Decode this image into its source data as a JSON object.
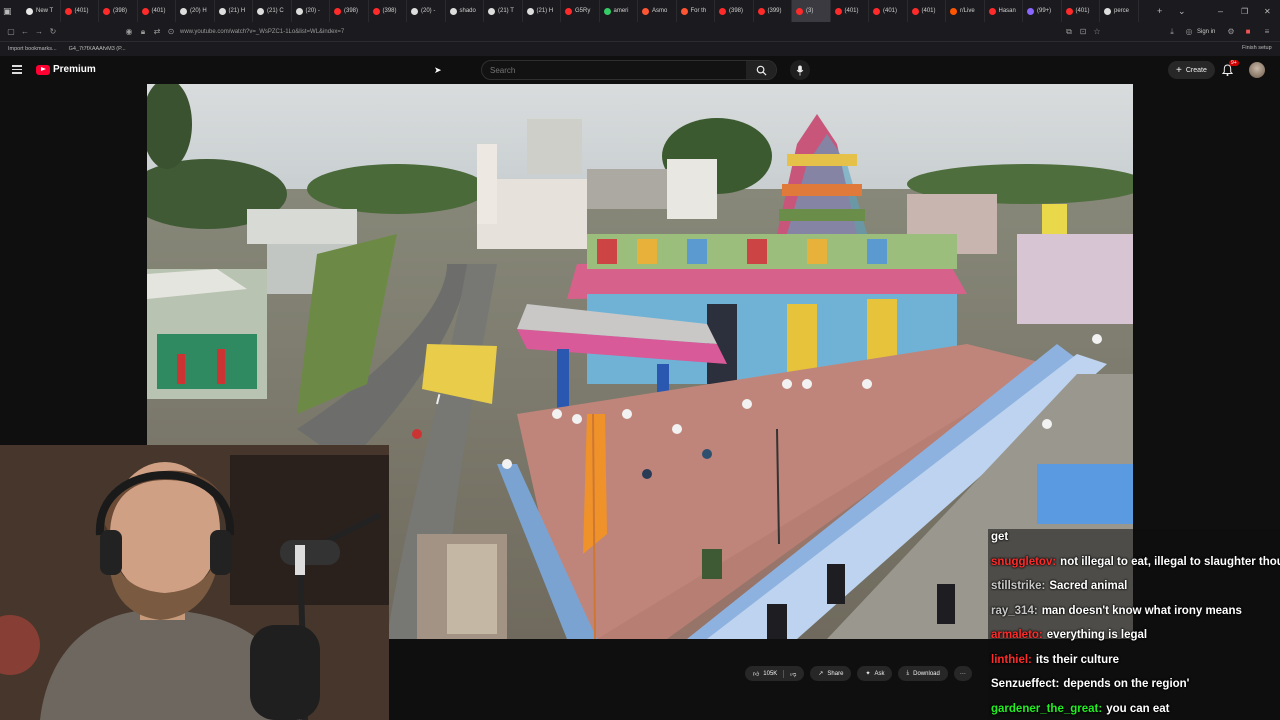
{
  "browser": {
    "tabs": [
      {
        "label": "New T",
        "color": "#e8e8e8"
      },
      {
        "label": "(401)",
        "color": "#ff2a2a"
      },
      {
        "label": "(398)",
        "color": "#ff2a2a"
      },
      {
        "label": "(401)",
        "color": "#ff2a2a"
      },
      {
        "label": "(20) H",
        "color": "#dddddd"
      },
      {
        "label": "(21) H",
        "color": "#dddddd"
      },
      {
        "label": "(21) C",
        "color": "#dddddd"
      },
      {
        "label": "(20) -",
        "color": "#dddddd"
      },
      {
        "label": "(398)",
        "color": "#ff2a2a"
      },
      {
        "label": "(398)",
        "color": "#ff2a2a"
      },
      {
        "label": "(20) -",
        "color": "#dddddd"
      },
      {
        "label": "shado",
        "color": "#dddddd"
      },
      {
        "label": "(21) T",
        "color": "#dddddd"
      },
      {
        "label": "(21) H",
        "color": "#dddddd"
      },
      {
        "label": "G5Ry",
        "color": "#ff2a2a"
      },
      {
        "label": "ameri",
        "color": "#33cc66"
      },
      {
        "label": "Asmo",
        "color": "#ff5533"
      },
      {
        "label": "For th",
        "color": "#ff5533"
      },
      {
        "label": "(398)",
        "color": "#ff2a2a"
      },
      {
        "label": "(399)",
        "color": "#ff2a2a"
      },
      {
        "label": "(3)",
        "color": "#ff2a2a"
      },
      {
        "label": "(401)",
        "color": "#ff2a2a"
      },
      {
        "label": "(401)",
        "color": "#ff2a2a"
      },
      {
        "label": "(401)",
        "color": "#ff2a2a"
      },
      {
        "label": "r/Live",
        "color": "#ff5500"
      },
      {
        "label": "Hasan",
        "color": "#ff2a2a"
      },
      {
        "label": "(99+)",
        "color": "#8866ff"
      },
      {
        "label": "(401)",
        "color": "#ff2a2a"
      },
      {
        "label": "perce",
        "color": "#dddddd"
      }
    ],
    "new_tab": "+",
    "tab_list": "⌄",
    "window_controls": [
      "–",
      "❐",
      "✕"
    ],
    "url": "www.youtube.com/watch?v=_WsPZC1-1Lo&list=WL&index=7",
    "sign_in": "Sign in",
    "finish_setup": "Finish setup",
    "bookmarks": [
      "Import bookmarks...",
      "G4_7t7fXAAAfvM3 (P..."
    ]
  },
  "youtube": {
    "logo_text": "Premium",
    "search_placeholder": "Search",
    "create_label": "Create",
    "notif_badge": "9+",
    "actions": {
      "like_count": "105K",
      "share": "Share",
      "ask": "Ask",
      "download": "Download",
      "more": "···"
    }
  },
  "chat": {
    "messages": [
      {
        "user": "",
        "text": "get",
        "color": "#ffffff"
      },
      {
        "user": "snuggletov:",
        "text": "not illegal to eat, illegal to slaughter though",
        "color": "#ff2a2a"
      },
      {
        "user": "stillstrike:",
        "text": "Sacred animal",
        "color": "#c8c8c8"
      },
      {
        "user": "ray_314:",
        "text": "man doesn't know what irony means",
        "color": "#c8c8c8"
      },
      {
        "user": "armaleto:",
        "text": "everything is legal",
        "color": "#ff2a2a"
      },
      {
        "user": "linthiel:",
        "text": "its their culture",
        "color": "#ff2a2a"
      },
      {
        "user": "Senzueffect:",
        "text": "depends on the region'",
        "color": "#ffffff"
      },
      {
        "user": "gardener_the_great:",
        "text": "you can eat",
        "color": "#22ee22"
      }
    ]
  }
}
